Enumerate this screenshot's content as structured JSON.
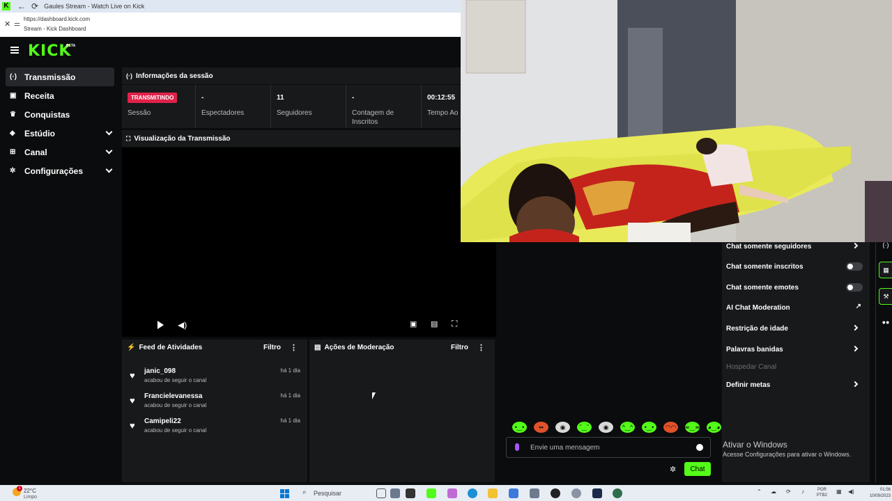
{
  "browser": {
    "tab_title": "Gaules Stream - Watch Live on Kick",
    "url": "https://dashboard.kick.com",
    "page_title": "Stream - Kick Dashboard"
  },
  "app": {
    "logo": "KICK",
    "logo_badge": "BETA"
  },
  "sidebar": {
    "items": [
      {
        "label": "Transmissão",
        "icon": "broadcast-icon",
        "active": true
      },
      {
        "label": "Receita",
        "icon": "revenue-icon"
      },
      {
        "label": "Conquistas",
        "icon": "trophy-icon"
      },
      {
        "label": "Estúdio",
        "icon": "studio-icon",
        "expandable": true
      },
      {
        "label": "Canal",
        "icon": "channel-icon",
        "expandable": true
      },
      {
        "label": "Configurações",
        "icon": "gear-icon",
        "expandable": true
      }
    ]
  },
  "session": {
    "title": "Informações da sessão",
    "status_badge": "TRANSMITINDO",
    "stats": [
      {
        "value": "",
        "label": "Sessão"
      },
      {
        "value": "-",
        "label": "Espectadores"
      },
      {
        "value": "11",
        "label": "Seguidores"
      },
      {
        "value": "-",
        "label": "Contagem de Inscritos"
      },
      {
        "value": "00:12:55",
        "label": "Tempo Ao"
      }
    ]
  },
  "preview": {
    "title": "Visualização da Transmissão"
  },
  "feed": {
    "title": "Feed de Atividades",
    "filter_label": "Filtro",
    "items": [
      {
        "user": "janic_098",
        "action": "acabou de seguir o canal",
        "time": "há 1 dia"
      },
      {
        "user": "Francielevanessa",
        "action": "acabou de seguir o canal",
        "time": "há 1 dia"
      },
      {
        "user": "Camipeli22",
        "action": "acabou de seguir o canal",
        "time": "há 1 dia"
      }
    ]
  },
  "moderation": {
    "title": "Ações de Moderação",
    "filter_label": "Filtro"
  },
  "chat": {
    "placeholder": "Envie uma mensagem",
    "send_label": "Chat"
  },
  "chat_settings": {
    "items": [
      {
        "label": "Chat somente seguidores",
        "control": "arrow"
      },
      {
        "label": "Chat somente inscritos",
        "control": "toggle"
      },
      {
        "label": "Chat somente emotes",
        "control": "toggle"
      },
      {
        "label": "AI Chat Moderation",
        "control": "external"
      },
      {
        "label": "Restrição de idade",
        "control": "arrow"
      },
      {
        "label": "Palavras banidas",
        "control": "arrow"
      },
      {
        "label": "Hospedar Canal",
        "control": "disabled"
      },
      {
        "label": "Definir metas",
        "control": "arrow"
      }
    ]
  },
  "watermark": {
    "line1": "Ativar o Windows",
    "line2": "Acesse Configurações para ativar o Windows."
  },
  "taskbar": {
    "temperature": "22°C",
    "condition": "Limpo",
    "alert_count": "1",
    "search_label": "Pesquisar",
    "lang_line1": "POR",
    "lang_line2": "PTB2",
    "time": "01:56",
    "date": "10/09/2023"
  },
  "colors": {
    "brand": "#53fc18",
    "live": "#e0224a",
    "panel": "#18191b",
    "background": "#0b0c0d"
  }
}
